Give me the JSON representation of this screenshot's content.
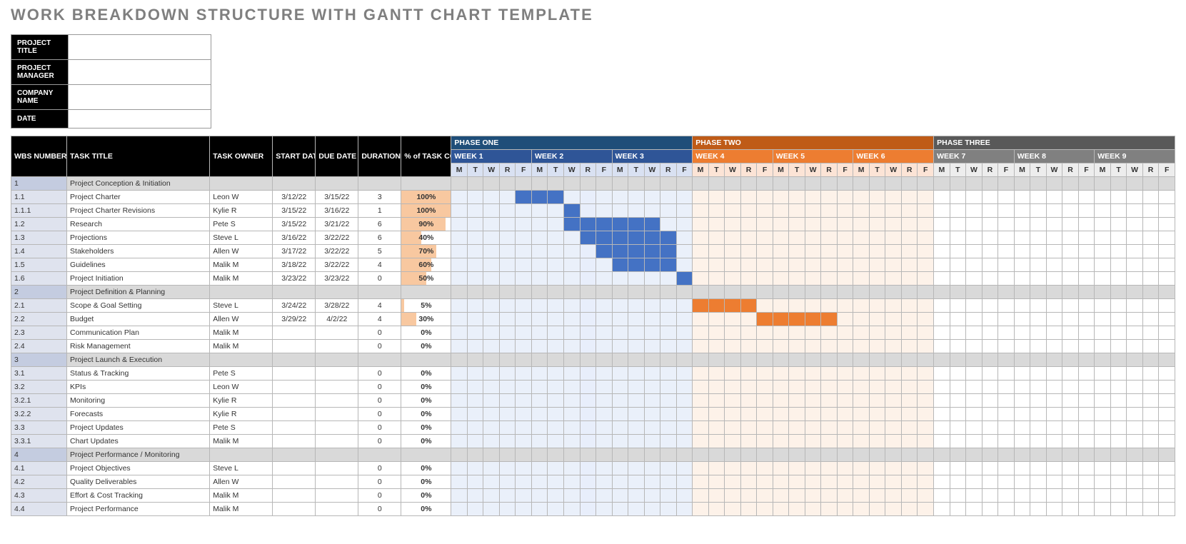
{
  "page_title": "WORK BREAKDOWN STRUCTURE WITH GANTT CHART TEMPLATE",
  "meta": {
    "labels": [
      "PROJECT TITLE",
      "PROJECT MANAGER",
      "COMPANY NAME",
      "DATE"
    ],
    "values": [
      "",
      "",
      "",
      ""
    ]
  },
  "columns": {
    "wbs": "WBS NUMBER",
    "title": "TASK TITLE",
    "owner": "TASK OWNER",
    "start": "START DATE",
    "due": "DUE DATE",
    "dur": "DURATION",
    "pct": "% of TASK COMPLETE"
  },
  "phases": [
    {
      "name": "PHASE ONE",
      "color": "one",
      "weeks": [
        "WEEK 1",
        "WEEK 2",
        "WEEK 3"
      ]
    },
    {
      "name": "PHASE TWO",
      "color": "two",
      "weeks": [
        "WEEK 4",
        "WEEK 5",
        "WEEK 6"
      ]
    },
    {
      "name": "PHASE THREE",
      "color": "three",
      "weeks": [
        "WEEK 7",
        "WEEK 8",
        "WEEK 9"
      ]
    }
  ],
  "day_labels": [
    "M",
    "T",
    "W",
    "R",
    "F"
  ],
  "chart_data": {
    "type": "gantt",
    "x_unit": "workday (M-F)",
    "total_days": 45,
    "phase_spans": [
      [
        0,
        15
      ],
      [
        15,
        30
      ],
      [
        30,
        45
      ]
    ],
    "week5_highlight_days": [
      20,
      21,
      22,
      23,
      24
    ],
    "week2r_highlight_day": 8,
    "tasks": [
      {
        "wbs": "1",
        "title": "Project Conception & Initiation",
        "section": true
      },
      {
        "wbs": "1.1",
        "title": "Project Charter",
        "owner": "Leon W",
        "start": "3/12/22",
        "due": "3/15/22",
        "dur": "3",
        "pct": 100,
        "bar": [
          4,
          7
        ],
        "phase": "one"
      },
      {
        "wbs": "1.1.1",
        "title": "Project Charter Revisions",
        "owner": "Kylie R",
        "start": "3/15/22",
        "due": "3/16/22",
        "dur": "1",
        "pct": 100,
        "bar": [
          7,
          8
        ],
        "phase": "one"
      },
      {
        "wbs": "1.2",
        "title": "Research",
        "owner": "Pete S",
        "start": "3/15/22",
        "due": "3/21/22",
        "dur": "6",
        "pct": 90,
        "bar": [
          7,
          13
        ],
        "phase": "one"
      },
      {
        "wbs": "1.3",
        "title": "Projections",
        "owner": "Steve L",
        "start": "3/16/22",
        "due": "3/22/22",
        "dur": "6",
        "pct": 40,
        "bar": [
          8,
          14
        ],
        "phase": "one"
      },
      {
        "wbs": "1.4",
        "title": "Stakeholders",
        "owner": "Allen W",
        "start": "3/17/22",
        "due": "3/22/22",
        "dur": "5",
        "pct": 70,
        "bar": [
          9,
          14
        ],
        "phase": "one"
      },
      {
        "wbs": "1.5",
        "title": "Guidelines",
        "owner": "Malik M",
        "start": "3/18/22",
        "due": "3/22/22",
        "dur": "4",
        "pct": 60,
        "bar": [
          10,
          14
        ],
        "phase": "one"
      },
      {
        "wbs": "1.6",
        "title": "Project Initiation",
        "owner": "Malik M",
        "start": "3/23/22",
        "due": "3/23/22",
        "dur": "0",
        "pct": 50,
        "bar": [
          14,
          15
        ],
        "phase": "one"
      },
      {
        "wbs": "2",
        "title": "Project Definition & Planning",
        "section": true
      },
      {
        "wbs": "2.1",
        "title": "Scope & Goal Setting",
        "owner": "Steve L",
        "start": "3/24/22",
        "due": "3/28/22",
        "dur": "4",
        "pct": 5,
        "bar": [
          15,
          19
        ],
        "phase": "two"
      },
      {
        "wbs": "2.2",
        "title": "Budget",
        "owner": "Allen W",
        "start": "3/29/22",
        "due": "4/2/22",
        "dur": "4",
        "pct": 30,
        "bar": [
          19,
          24
        ],
        "phase": "two"
      },
      {
        "wbs": "2.3",
        "title": "Communication Plan",
        "owner": "Malik M",
        "start": "",
        "due": "",
        "dur": "0",
        "pct": 0
      },
      {
        "wbs": "2.4",
        "title": "Risk Management",
        "owner": "Malik M",
        "start": "",
        "due": "",
        "dur": "0",
        "pct": 0
      },
      {
        "wbs": "3",
        "title": "Project Launch & Execution",
        "section": true
      },
      {
        "wbs": "3.1",
        "title": "Status & Tracking",
        "owner": "Pete S",
        "start": "",
        "due": "",
        "dur": "0",
        "pct": 0
      },
      {
        "wbs": "3.2",
        "title": "KPIs",
        "owner": "Leon W",
        "start": "",
        "due": "",
        "dur": "0",
        "pct": 0
      },
      {
        "wbs": "3.2.1",
        "title": "Monitoring",
        "owner": "Kylie R",
        "start": "",
        "due": "",
        "dur": "0",
        "pct": 0
      },
      {
        "wbs": "3.2.2",
        "title": "Forecasts",
        "owner": "Kylie R",
        "start": "",
        "due": "",
        "dur": "0",
        "pct": 0
      },
      {
        "wbs": "3.3",
        "title": "Project Updates",
        "owner": "Pete S",
        "start": "",
        "due": "",
        "dur": "0",
        "pct": 0
      },
      {
        "wbs": "3.3.1",
        "title": "Chart Updates",
        "owner": "Malik M",
        "start": "",
        "due": "",
        "dur": "0",
        "pct": 0
      },
      {
        "wbs": "4",
        "title": "Project Performance / Monitoring",
        "section": true
      },
      {
        "wbs": "4.1",
        "title": "Project Objectives",
        "owner": "Steve L",
        "start": "",
        "due": "",
        "dur": "0",
        "pct": 0
      },
      {
        "wbs": "4.2",
        "title": "Quality Deliverables",
        "owner": "Allen W",
        "start": "",
        "due": "",
        "dur": "0",
        "pct": 0
      },
      {
        "wbs": "4.3",
        "title": "Effort & Cost Tracking",
        "owner": "Malik M",
        "start": "",
        "due": "",
        "dur": "0",
        "pct": 0
      },
      {
        "wbs": "4.4",
        "title": "Project Performance",
        "owner": "Malik M",
        "start": "",
        "due": "",
        "dur": "0",
        "pct": 0
      }
    ]
  }
}
